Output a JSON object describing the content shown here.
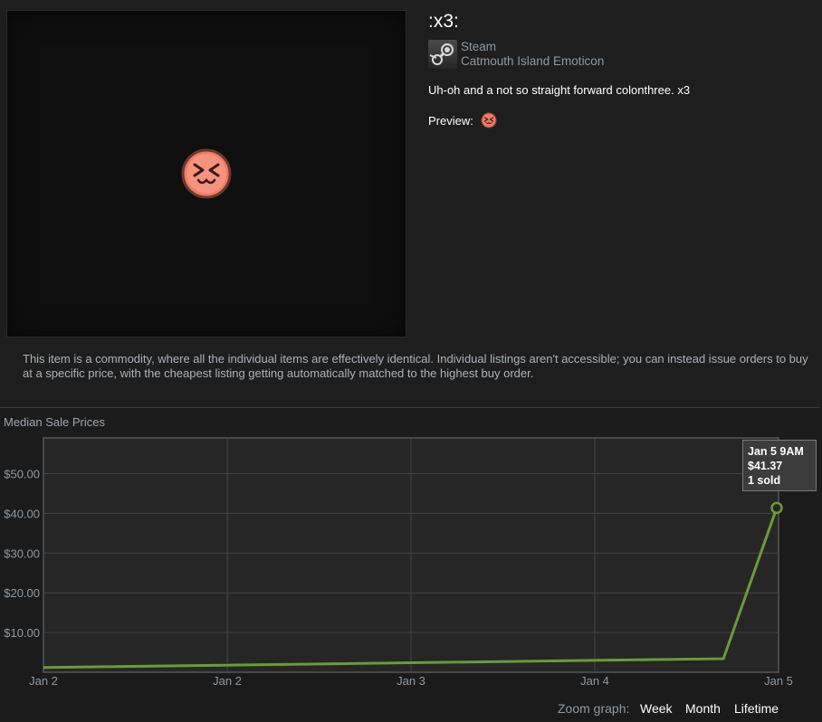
{
  "item": {
    "title": ":x3:",
    "app_name": "Steam",
    "type": "Catmouth Island Emoticon",
    "description": "Uh-oh and a not so straight forward colonthree. x3",
    "preview_label": "Preview:",
    "app_icon": "steam-logo-icon",
    "emoticon_icon": "x3-face-emoticon"
  },
  "commodity_note": "This item is a commodity, where all the individual items are effectively identical. Individual listings aren't accessible; you can instead issue orders to buy at a specific price, with the cheapest listing getting automatically matched to the highest buy order.",
  "graph": {
    "title": "Median Sale Prices",
    "tooltip": {
      "date": "Jan 5 9AM",
      "price": "$41.37",
      "sold": "1 sold"
    },
    "zoom_label": "Zoom graph:",
    "zoom_options": [
      "Week",
      "Month",
      "Lifetime"
    ]
  },
  "colors": {
    "line": "#6c9a3a",
    "plot_background": "#262626",
    "grid": "#444444",
    "page_background": "#1b1b1b"
  },
  "chart_data": {
    "type": "line",
    "title": "Median Sale Prices",
    "xlabel": "",
    "ylabel": "",
    "x_ticks": [
      "Jan 2",
      "Jan 2",
      "Jan 3",
      "Jan 4",
      "Jan 5"
    ],
    "y_ticks": [
      "$10.00",
      "$20.00",
      "$30.00",
      "$40.00",
      "$50.00"
    ],
    "ylim": [
      0,
      59
    ],
    "grid": true,
    "series": [
      {
        "x": [
          "Jan 2",
          "Jan 4 ~11PM",
          "Jan 5 9AM"
        ],
        "values": [
          1.2,
          3.4,
          41.37
        ]
      }
    ],
    "highlighted_point": {
      "x": "Jan 5 9AM",
      "value": 41.37,
      "volume": 1
    }
  }
}
